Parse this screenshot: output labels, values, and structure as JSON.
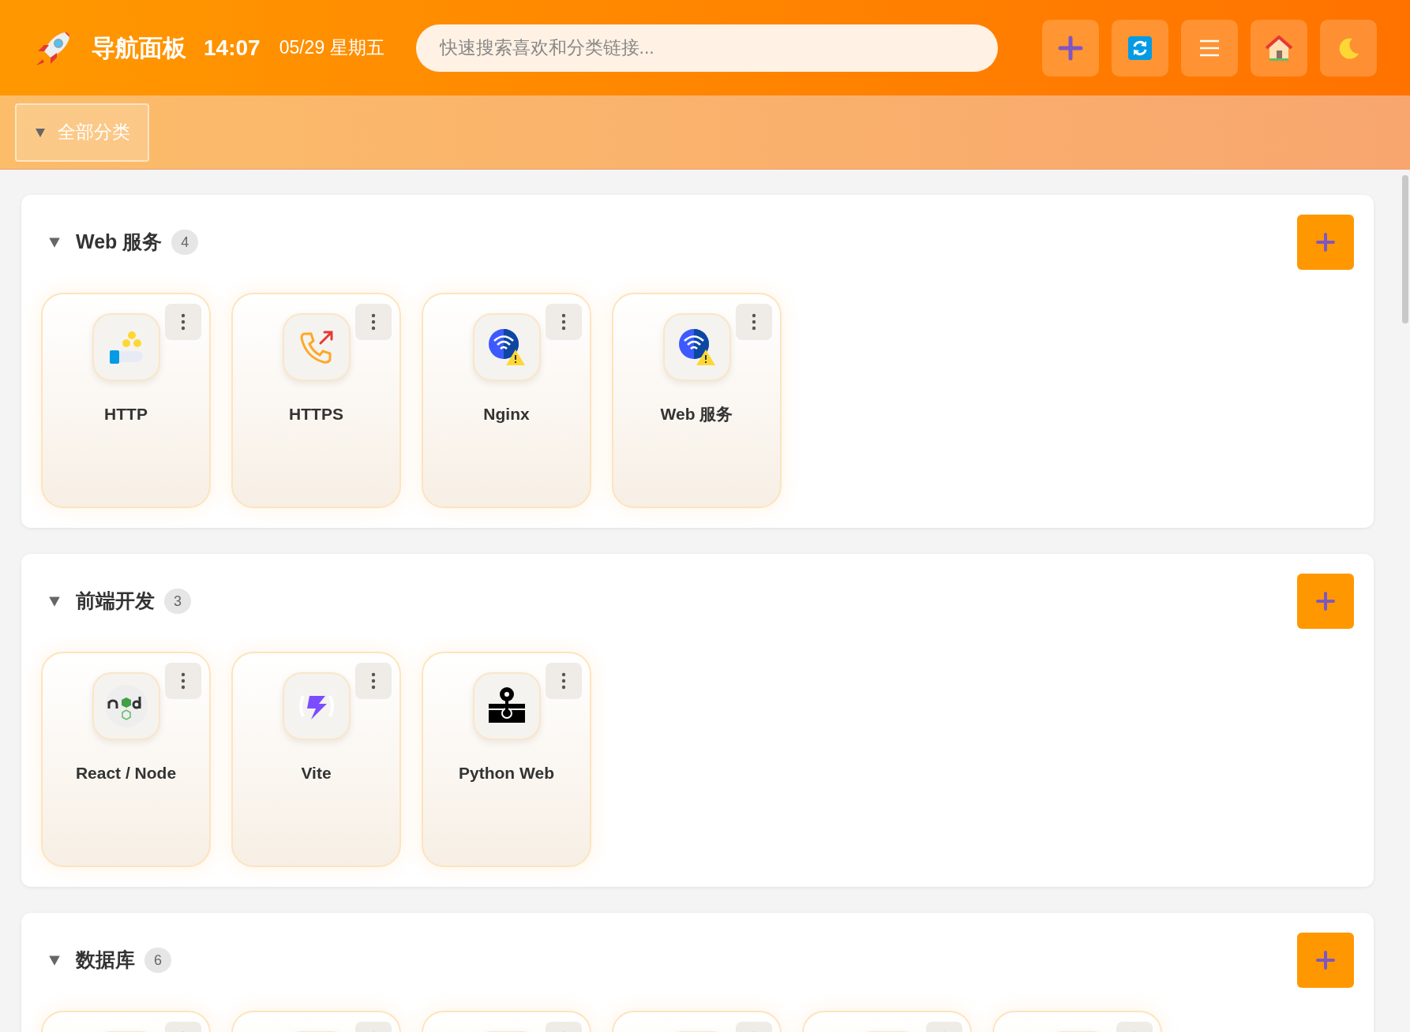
{
  "header": {
    "title": "导航面板",
    "time": "14:07",
    "date": "05/29 星期五",
    "search": {
      "placeholder": "快速搜索喜欢和分类链接..."
    }
  },
  "filter": {
    "label": "全部分类",
    "expanded": true
  },
  "sections": [
    {
      "title": "Web 服务",
      "count": "4",
      "expanded": true,
      "items": [
        {
          "kind": "tile",
          "name": "HTTP"
        },
        {
          "kind": "tile",
          "name": "HTTPS"
        },
        {
          "kind": "tile",
          "name": "Nginx"
        },
        {
          "kind": "tile",
          "name": "Web 服务"
        }
      ]
    },
    {
      "title": "前端开发",
      "count": "3",
      "expanded": true,
      "items": [
        {
          "kind": "tile",
          "name": "React / Node"
        },
        {
          "kind": "tile",
          "name": "Vite"
        },
        {
          "kind": "tile",
          "name": "Python Web"
        }
      ]
    },
    {
      "title": "数据库",
      "count": "6",
      "expanded": true,
      "items": [
        {
          "kind": "tile"
        },
        {
          "kind": "tile"
        },
        {
          "kind": "tile"
        },
        {
          "kind": "tile"
        },
        {
          "kind": "tile"
        },
        {
          "kind": "tile"
        }
      ]
    }
  ]
}
